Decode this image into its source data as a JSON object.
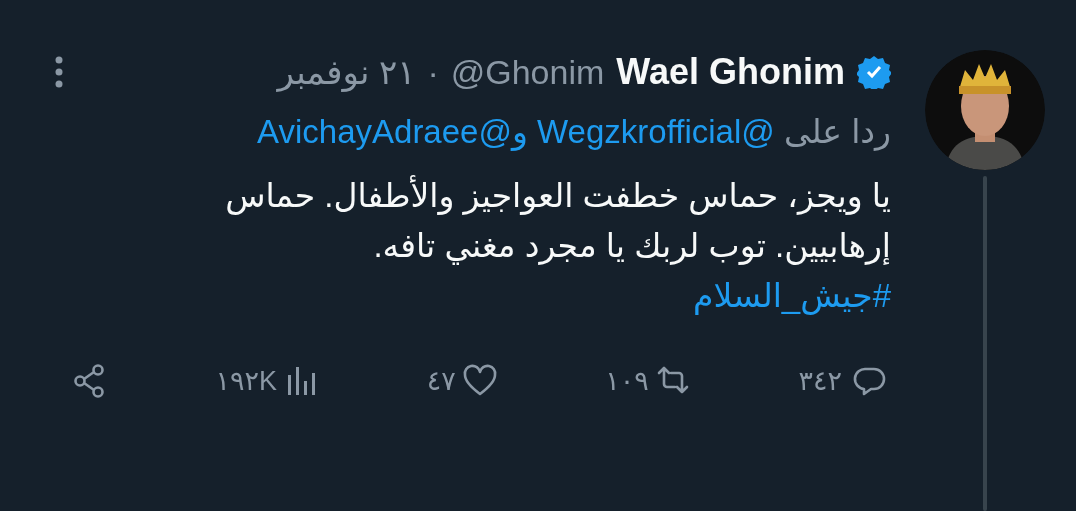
{
  "tweet": {
    "author": {
      "name": "Wael Ghonim",
      "verified": true,
      "handle": "@Ghonim",
      "separator": "·",
      "date": "٢١ نوفمبر"
    },
    "reply_to": {
      "prefix": "ردا على",
      "mentions": [
        "@Wegzkrofficial",
        "و@AvichayAdraee"
      ]
    },
    "text_lines": [
      "يا ويجز، حماس خطفت العواجيز والأطفال. حماس",
      "إرهابيين. توب لربك يا مجرد مغني تافه."
    ],
    "hashtag": "#جيش_السلام",
    "actions": [
      {
        "kind": "reply",
        "count": "٣٤٢"
      },
      {
        "kind": "retweet",
        "count": "١٠٩"
      },
      {
        "kind": "like",
        "count": "٤٧"
      },
      {
        "kind": "views",
        "count": "١٩٢K"
      },
      {
        "kind": "share"
      }
    ]
  }
}
